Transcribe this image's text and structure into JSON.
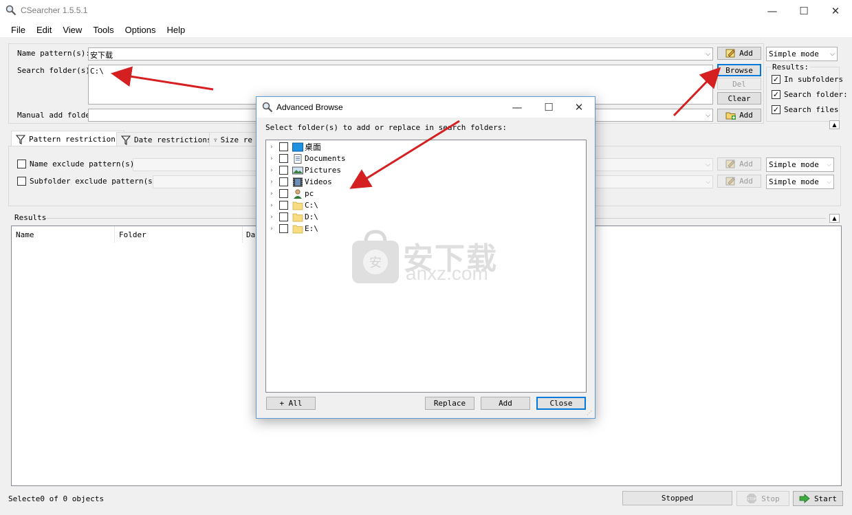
{
  "window": {
    "title": "CSearcher 1.5.5.1"
  },
  "menu": [
    "File",
    "Edit",
    "View",
    "Tools",
    "Options",
    "Help"
  ],
  "search": {
    "name_pattern_label": "Name pattern(s):",
    "name_pattern_value": "安下载",
    "search_folder_label": "Search folder(s):",
    "search_folder_value": "C:\\",
    "manual_add_label": "Manual add folder",
    "add_label": "Add",
    "browse_label": "Browse",
    "del_label": "Del",
    "clear_label": "Clear",
    "mode_value": "Simple mode"
  },
  "results_options": {
    "title": "Results:",
    "in_subfolders": "In subfolders",
    "search_folder": "Search folder:",
    "search_files": "Search files"
  },
  "tabs": [
    "Pattern restrictions",
    "Date restrictions",
    "Size re"
  ],
  "restrictions": {
    "name_exclude_label": "Name exclude pattern(s):",
    "subfolder_exclude_label": "Subfolder exclude pattern(s):",
    "add_label": "Add",
    "mode_value": "Simple mode"
  },
  "results": {
    "title": "Results",
    "columns": [
      "Name",
      "Folder",
      "Da"
    ]
  },
  "status": {
    "selected_text": "Selecte0 of 0 objects",
    "state": "Stopped",
    "stop_label": "Stop",
    "start_label": "Start"
  },
  "dialog": {
    "title": "Advanced Browse",
    "instruction": "Select folder(s) to add or replace in search folders:",
    "items": [
      {
        "label": "桌面",
        "icon": "desktop-icon"
      },
      {
        "label": "Documents",
        "icon": "documents-icon"
      },
      {
        "label": "Pictures",
        "icon": "pictures-icon"
      },
      {
        "label": "Videos",
        "icon": "videos-icon"
      },
      {
        "label": "pc",
        "icon": "user-icon"
      },
      {
        "label": "C:\\",
        "icon": "folder-icon"
      },
      {
        "label": "D:\\",
        "icon": "folder-icon"
      },
      {
        "label": "E:\\",
        "icon": "folder-icon"
      }
    ],
    "all_label": "+ All",
    "replace_label": "Replace",
    "add_label": "Add",
    "close_label": "Close"
  },
  "watermark": {
    "cn": "安下载",
    "en": "anxz.com"
  },
  "colors": {
    "accent": "#0078d7",
    "arrow": "#d42020"
  }
}
